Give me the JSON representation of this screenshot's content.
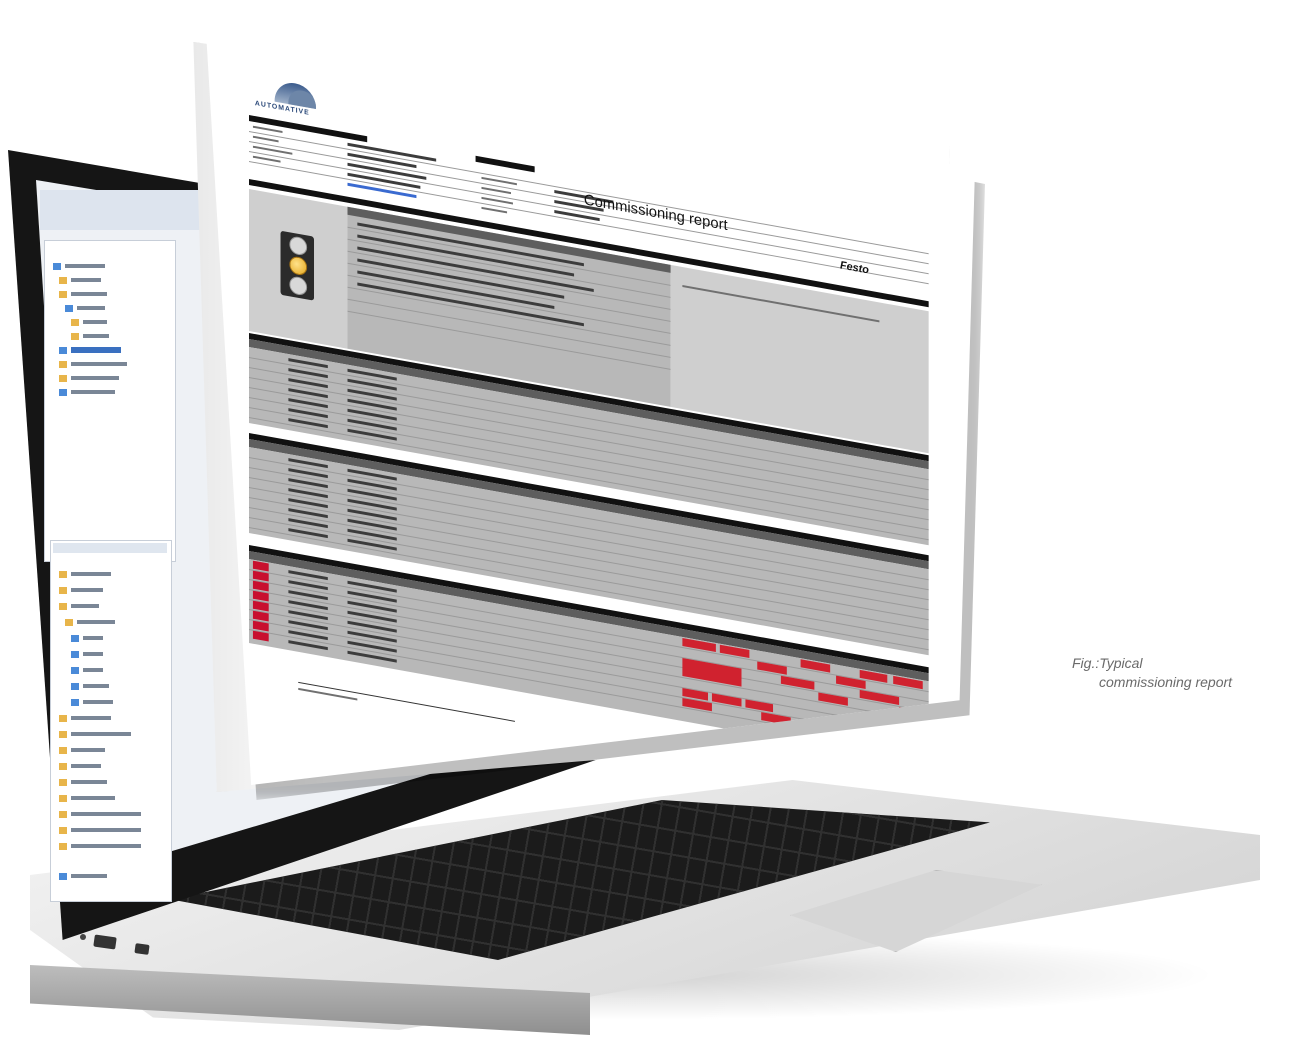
{
  "report": {
    "title": "Commissioning report"
  },
  "caption": {
    "prefix": "Fig.:",
    "line1": "Typical",
    "line2": "commissioning report"
  }
}
